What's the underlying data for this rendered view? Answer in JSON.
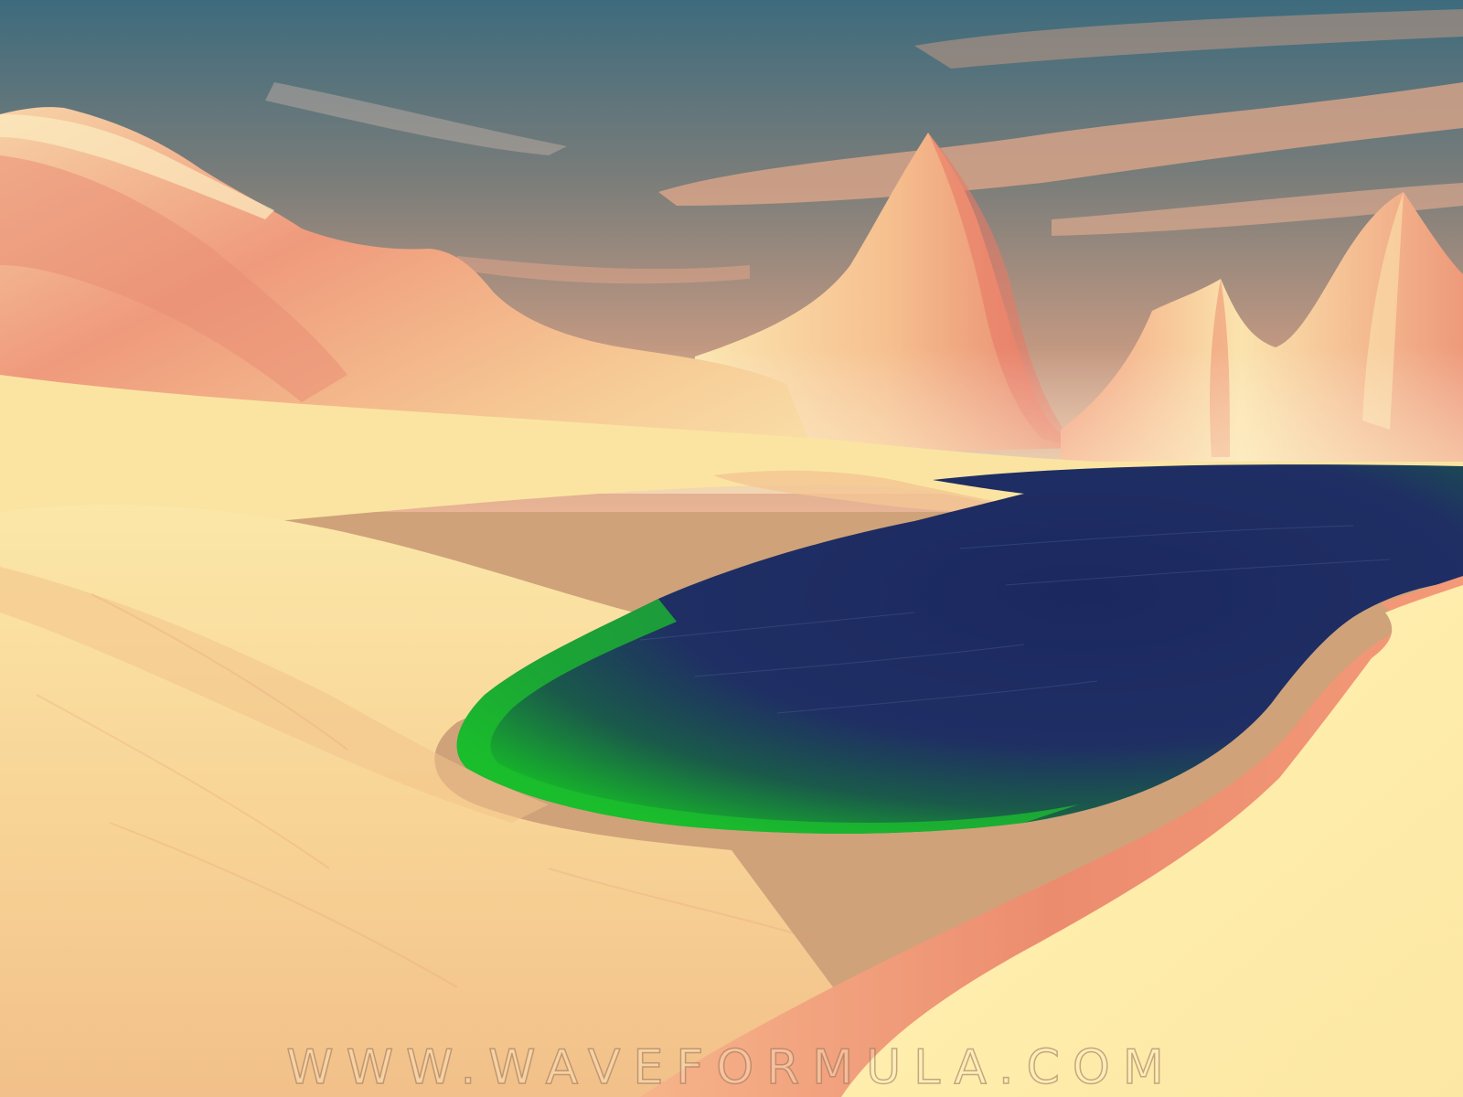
{
  "image": {
    "subject": "",
    "colors": {
      "sky_top": "#3f6f80",
      "sky_horizon": "#d9a887",
      "cloud": "#e8b08e",
      "peak_highlight": "#fbe9b4",
      "peak_shadow": "#e97c66",
      "sand_light": "#fff4b3",
      "sand_mid": "#f5c98a",
      "sand_shadow": "#ec8d6f",
      "water_deep": "#1c2a5c",
      "water_mid": "#23346a",
      "water_shallow": "#13b22b"
    }
  },
  "watermark": {
    "text": "WWW.WAVEFORMULA.COM"
  }
}
